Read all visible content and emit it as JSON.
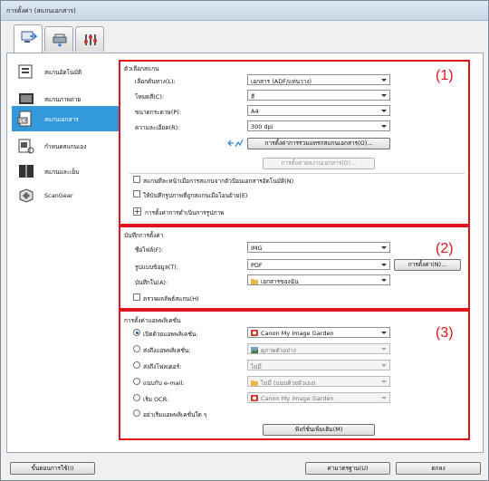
{
  "window": {
    "title": "การตั้งค่า (สแกนเอกสาร)"
  },
  "tabs": [
    {
      "icon": "scan-from-computer-icon"
    },
    {
      "icon": "scan-from-panel-icon"
    },
    {
      "icon": "general-settings-icon"
    }
  ],
  "sidebar": {
    "items": [
      {
        "label": "สแกนอัตโนมัติ",
        "icon": "auto-scan-icon"
      },
      {
        "label": "สแกนภาพถ่าย",
        "icon": "photo-scan-icon"
      },
      {
        "label": "สแกนเอกสาร",
        "icon": "document-scan-icon"
      },
      {
        "label": "กำหนดสแกนเอง",
        "icon": "custom-scan-icon"
      },
      {
        "label": "สแกนและเย็บ",
        "icon": "scan-stitch-icon"
      },
      {
        "label": "ScanGear",
        "icon": "scangear-icon"
      }
    ],
    "active_index": 2
  },
  "section1": {
    "number": "(1)",
    "title": "ตัวเลือกสแกน",
    "fields": {
      "source_label": "เลือกต้นทาง(L):",
      "source_value": "เอกสาร (ADF/แท่นวาง)",
      "color_label": "โหมดสี(C):",
      "color_value": "สี",
      "paper_label": "ขนาดกระดาษ(P):",
      "paper_value": "A4",
      "resolution_label": "ความละเอียด(R):",
      "resolution_value": "300 dpi"
    },
    "driver_button": "การตั้งค่าการรวมแทรกสแกนเอกสาร(O)...",
    "doc_button": "การตั้งค่าผลงานเอกสาร(D)...",
    "check1": "สแกนทีละหน้าเมื่อการสแกนจากตัวป้อนเอกสารอัตโนมัติ(N)",
    "check2": "ให้บันทึกรูปภาพที่ถูกสแกนเมื่อโอนย้าย(E)",
    "expand_label": "การตั้งค่าการดำเนินการรูปภาพ"
  },
  "section2": {
    "number": "(2)",
    "title": "บันทึกการตั้งค่า",
    "file_name_label": "ชื่อไฟล์(F):",
    "file_name_value": "IMG",
    "data_format_label": "รูปแบบข้อมูล(T):",
    "data_format_value": "PDF",
    "settings_button": "การตั้งค่า(N)...",
    "save_in_label": "บันทึกใน(A):",
    "save_in_value": "เอกสารของฉัน",
    "check_label": "ตรวจผลลัพธ์สแกน(H)"
  },
  "section3": {
    "number": "(3)",
    "title": "การตั้งค่าแอพพลิเคชั่น",
    "options": [
      {
        "label": "เปิดด้วยแอพพลิเคชั่น:",
        "value": "Canon My Image Garden",
        "selected": true,
        "disabled": false,
        "icon": "image-garden-icon"
      },
      {
        "label": "ส่งถึงแอพพลิเคชั่น:",
        "value": "ดูภาพตัวอย่าง",
        "selected": false,
        "disabled": true,
        "icon": "preview-icon"
      },
      {
        "label": "ส่งถึงโฟลเดอร์:",
        "value": "ไม่มี",
        "selected": false,
        "disabled": true,
        "icon": ""
      },
      {
        "label": "แนบกับ e-mail:",
        "value": "ไม่มี (แนบด้วยตัวเอง)",
        "selected": false,
        "disabled": true,
        "icon": "mail-folder-icon"
      },
      {
        "label": "เริ่ม OCR:",
        "value": "Canon My Image Garden",
        "selected": false,
        "disabled": true,
        "icon": "image-garden-icon"
      },
      {
        "label": "อย่าเริ่มแอพพลิเคชั่นใด ๆ",
        "value": "",
        "selected": false,
        "disabled": false,
        "icon": ""
      }
    ],
    "more_button": "ฟังก์ชั่นเพิ่มเติม(M)"
  },
  "footer": {
    "instructions_button": "ขั้นตอนการใช้(I)",
    "defaults_button": "ค่ามาตรฐาน(U)",
    "ok_button": "ตกลง"
  },
  "colors": {
    "highlight": "#3399dd",
    "annotation": "#e0141c"
  }
}
